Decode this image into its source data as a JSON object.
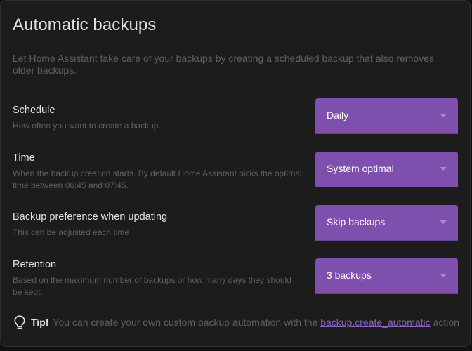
{
  "card": {
    "title": "Automatic backups",
    "intro": "Let Home Assistant take care of your backups by creating a scheduled backup that also removes older backups."
  },
  "settings": {
    "schedule": {
      "label": "Schedule",
      "description": "How often you want to create a backup.",
      "value": "Daily"
    },
    "time": {
      "label": "Time",
      "description": "When the backup creation starts. By default Home Assistant picks the optimal time between 06:45 and 07:45.",
      "value": "System optimal"
    },
    "preference": {
      "label": "Backup preference when updating",
      "description": "This can be adjusted each time",
      "value": "Skip backups"
    },
    "retention": {
      "label": "Retention",
      "description": "Based on the maximum number of backups or how many days they should be kept.",
      "value": "3 backups"
    }
  },
  "tip": {
    "icon": "lightbulb-icon",
    "label": "Tip!",
    "text_before": "You can create your own custom backup automation with the",
    "link": "backup.create_automatic",
    "text_after": "action"
  },
  "colors": {
    "accent": "#7e4fad",
    "link": "#8d62c2",
    "background": "#1c1c1c"
  }
}
